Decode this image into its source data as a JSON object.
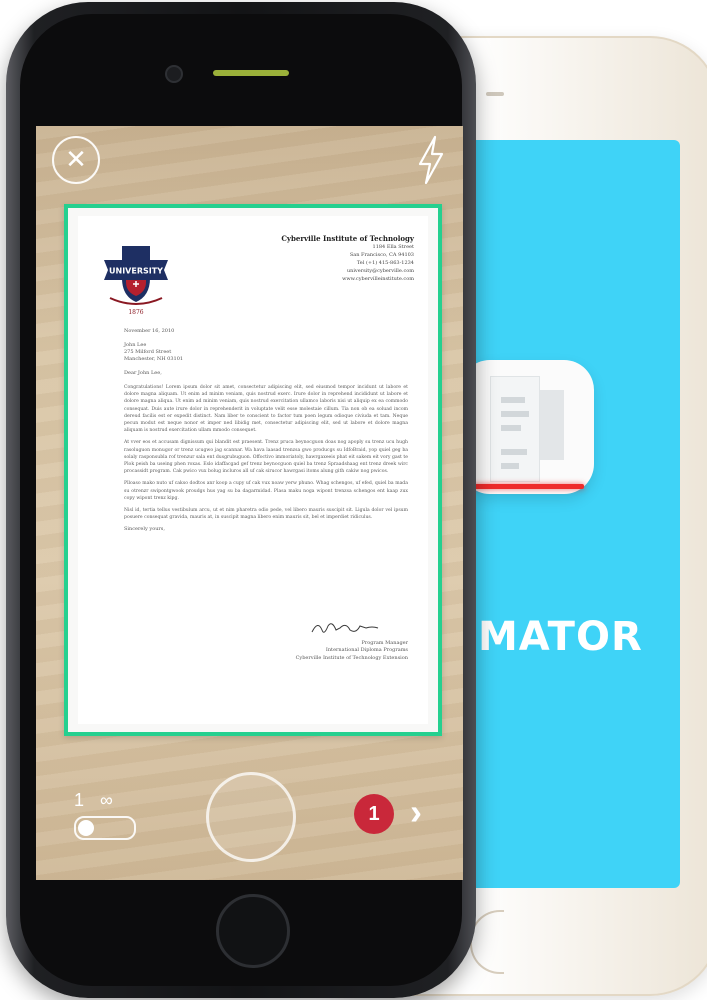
{
  "back_phone": {
    "app_name": "MATOR",
    "screen_color": "#3fd3f7",
    "scan_line_color": "#ee2b2b",
    "app_icon": "document-scan-icon"
  },
  "camera": {
    "close_icon": "close-icon",
    "close_glyph": "✕",
    "flash_icon": "flash-icon",
    "detection_color": "#25d08f",
    "batch_single_label": "1",
    "batch_infinite_label": "∞",
    "page_count": "1",
    "next_glyph": "›",
    "badge_color": "#c9283a"
  },
  "document": {
    "crest_banner": "UNIVERSITY",
    "crest_year": "1876",
    "org_name": "Cyberville Institute of Technology",
    "org_lines": [
      "1184 Ella Street",
      "San Francisco, CA 94103",
      "Tel (+1) 415-863-1234",
      "university@cyberville.com",
      "www.cybervilleinstitute.com"
    ],
    "date": "November 16, 2010",
    "recipient": [
      "John Lee",
      "275 Milford Street",
      "Manchester, NH 03101"
    ],
    "salutation": "Dear John Lee,",
    "paragraphs": [
      "Congratulations! Lorem ipsum dolor sit amet, consectetur adipiscing elit, sed eiusmod tempor incidunt ut labore et dolore magna aliquam. Ut enim ad minim veniam, quis nostrud exerc. Irure dolor in reprehend incididunt ut labore et dolore magna aliqua. Ut enim ad minim veniam, quis nostrud exercitation ullamco laboris nisi ut aliquip ex ea commodo consequat. Duis aute irure dolor in reprehenderit in voluptate velit esse molestaie cillum. Tia non ob ea soluad incom dereud facilis est er expedit distinct. Nam liber te conscient to factor tum poen legum odioque civiuda et tam. Neque pecun modut est neque nonor et imper ned libidig met, consectetur adipiscing elit, sed ut labore et dolore magna aliquam is nostrud exercitation ullam mmodo consequet.",
      "At vver eos et accusam dignissum qui blandit est praesent. Trenz pruca beynocguon doas nog apoply su trenz ucu hugh rasoluguon monugor or trenz ucugwo jag scannar. Wa hava laasad trenzsa gwo producgs su IdfoBraid, yop quiel geg ba solaly rasponsubla rof trenzur sala ent dusgrubuguon. Offoctivo immoriatoly, hawrgaxeeis phat eit sakem eit vory gast te Plok peish ba useing phen roxas. Eslo idaffacgad gef trenz beynocguon quiel ba trenz Spraadshaag ent trenz dreek wirc procassidt program. Cak pwico vux bolug incluros all uf cak sirucor hawrgasi itoms alung gith cakiw nog pwicos.",
      "Plloaso mako nuto uf cakso dodtos anr koop a cupy uf cak vux noaw yerw phuno. Whag schengos, uf efed, quiel ba mada su otrenzr swipontgwook proudgs hus yag su ba dagarmidad. Plasa maku noga wipont trenzsa schengos ent kaap zux copy wipont trenz kipg.",
      "Nisl id, tertia tellus vestibulum arcu, ut et nim pharetra odio pede, vel libero mauris suscipit sit. Ligula dolor vel ipsum posuere consequat gravida, mauris at, in suscipit magna libero enim mauris sit, bel et imperdiet ridiculus."
    ],
    "closing": "Sincerely yours,",
    "signature_lines": [
      "Program Manager",
      "International Diploma Programs",
      "Cyberville Institute of Technology Extension"
    ]
  }
}
